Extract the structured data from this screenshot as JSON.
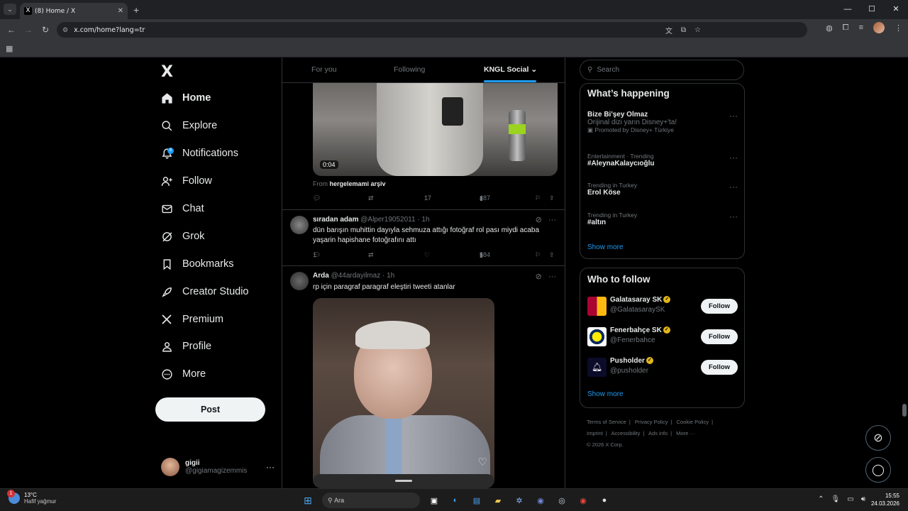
{
  "browser": {
    "tab_title": "(8) Home / X",
    "tab_favicon": "X",
    "url": "x.com/home?lang=tr",
    "window_controls": [
      "—",
      "☐",
      "✕"
    ]
  },
  "sidebar": {
    "logo": "X",
    "items": [
      {
        "label": "Home",
        "icon": "home-icon",
        "active": true
      },
      {
        "label": "Explore",
        "icon": "search-icon"
      },
      {
        "label": "Notifications",
        "icon": "bell-icon",
        "badge": "8"
      },
      {
        "label": "Follow",
        "icon": "add-person-icon"
      },
      {
        "label": "Chat",
        "icon": "mail-icon"
      },
      {
        "label": "Grok",
        "icon": "grok-icon"
      },
      {
        "label": "Bookmarks",
        "icon": "bookmark-icon"
      },
      {
        "label": "Creator Studio",
        "icon": "rocket-icon"
      },
      {
        "label": "Premium",
        "icon": "x-icon"
      },
      {
        "label": "Profile",
        "icon": "person-icon"
      },
      {
        "label": "More",
        "icon": "more-circle-icon"
      }
    ],
    "post_label": "Post",
    "account": {
      "name": "gigii",
      "handle": "@gigiamagizemmis",
      "more": "···"
    }
  },
  "feed": {
    "tabs": [
      "For you",
      "Following",
      "KNGL Social"
    ],
    "tweet0": {
      "duration": "0:04",
      "from_prefix": "From",
      "from_source": "hergelemami arşiv",
      "likes": "17",
      "views": "487"
    },
    "tweet1": {
      "name": "sıradan adam",
      "meta": "@Alper19052011 · 1h",
      "text": "dün barışın muhittin dayıyla sehmuza attığı fotoğraf rol pası miydi acaba yaşarin hapishane fotoğrafını attı",
      "replies": "1",
      "views": "584"
    },
    "tweet2": {
      "name": "Arda",
      "meta": "@44ardayilmaz · 1h",
      "text": "rp için paragraf paragraf eleştiri tweeti atanlar"
    }
  },
  "right": {
    "search_placeholder": "Search",
    "happening_title": "What’s happening",
    "trends": [
      {
        "ctx": "",
        "title": "Bize Bi'şey Olmaz",
        "sub": "Orijinal dizi yarın Disney+'ta!",
        "promo": "Promoted by Disney+ Türkiye"
      },
      {
        "ctx": "Entertainment · Trending",
        "title": "#AleynaKalaycıoğlu"
      },
      {
        "ctx": "Trending in Turkey",
        "title": "Erol Köse"
      },
      {
        "ctx": "Trending in Turkey",
        "title": "#altın"
      }
    ],
    "show_more": "Show more",
    "who_title": "Who to follow",
    "follow_label": "Follow",
    "who": [
      {
        "name": "Galatasaray SK",
        "handle": "@GalatasaraySK",
        "color": "#a90432"
      },
      {
        "name": "Fenerbahçe SK",
        "handle": "@Fenerbahce",
        "color": "#ffffff"
      },
      {
        "name": "Pusholder",
        "handle": "@pusholder",
        "color": "#0b0b2a"
      }
    ],
    "footer": [
      "Terms of Service",
      "|",
      "Privacy Policy",
      "|",
      "Cookie Policy",
      "|",
      "Imprint",
      "|",
      "Accessibility",
      "|",
      "Ads info",
      "|",
      "More ···",
      "© 2026 X Corp."
    ]
  },
  "taskbar": {
    "temp": "13°C",
    "weather": "Hafif yağmur",
    "weather_badge": "1",
    "search": "Ara",
    "time": "15:55",
    "date": "24.03.2026"
  }
}
